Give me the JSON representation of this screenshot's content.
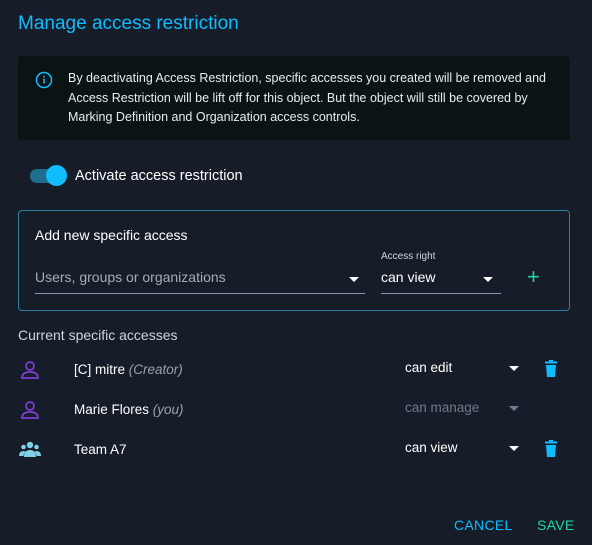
{
  "dialog": {
    "title": "Manage access restriction",
    "info_text": "By deactivating Access Restriction, specific accesses you created will be removed and Access Restriction will be lift off for this object. But the object will still be covered by Marking Definition and Organization access controls.",
    "toggle": {
      "label": "Activate access restriction",
      "checked": true
    }
  },
  "add_access": {
    "title": "Add new specific access",
    "users_placeholder": "Users, groups or organizations",
    "access_right_label": "Access right",
    "access_right_value": "can view"
  },
  "current": {
    "title": "Current specific accesses",
    "rows": [
      {
        "name": "[C] mitre",
        "note": "(Creator)",
        "access": "can edit",
        "icon": "user-icon",
        "deletable": true,
        "disabled": false
      },
      {
        "name": "Marie Flores",
        "note": "(you)",
        "access": "can manage",
        "icon": "user-icon",
        "deletable": false,
        "disabled": true
      },
      {
        "name": "Team A7",
        "note": "",
        "access": "can view",
        "icon": "group-icon",
        "deletable": true,
        "disabled": false
      }
    ]
  },
  "actions": {
    "cancel": "CANCEL",
    "save": "SAVE"
  },
  "colors": {
    "accent": "#0fbcff",
    "success": "#1fd7a0",
    "user_icon": "#7b3fd6",
    "group_icon": "#7fd0e8"
  }
}
